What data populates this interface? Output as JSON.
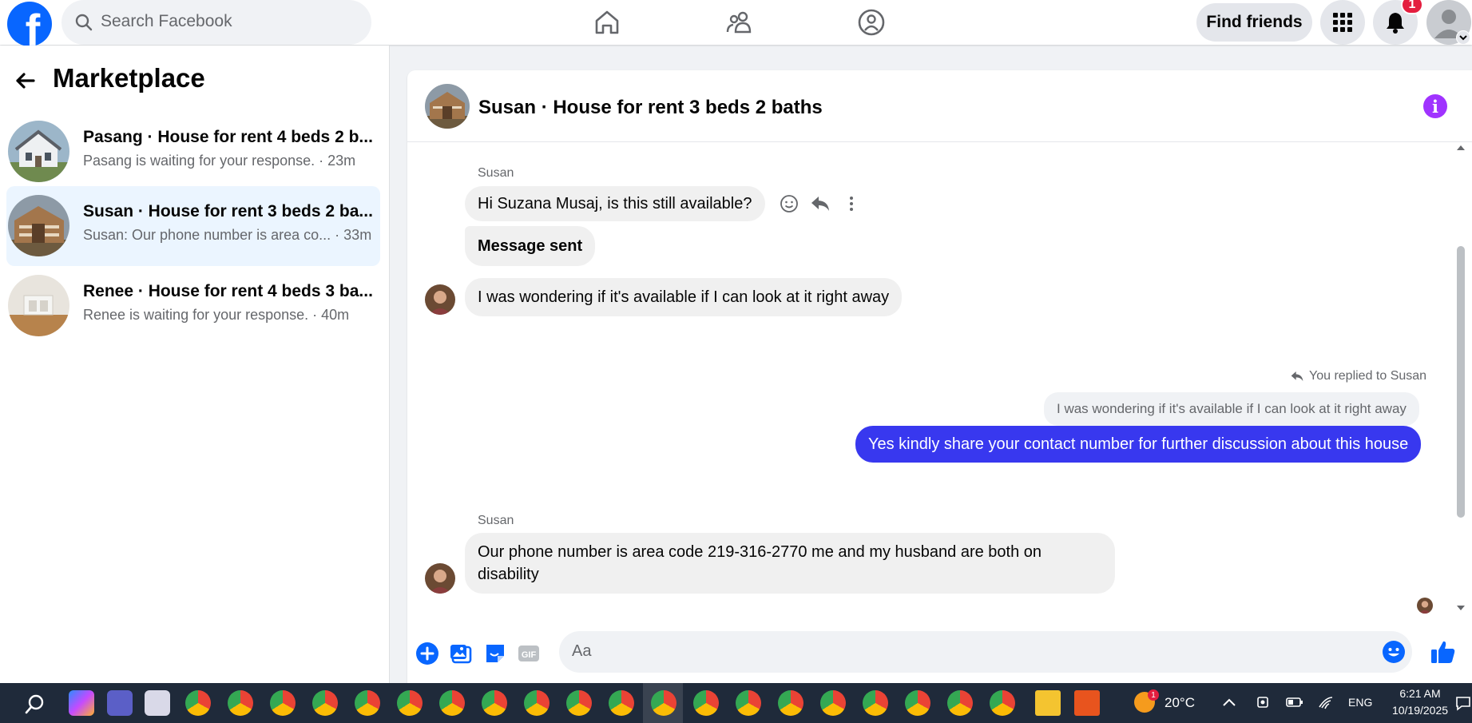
{
  "topbar": {
    "search_placeholder": "Search Facebook",
    "find_friends_label": "Find friends",
    "notification_count": "1"
  },
  "sidebar": {
    "title": "Marketplace",
    "conversations": [
      {
        "name": "Pasang · House for rent 4 beds 2 b...",
        "subtitle": "Pasang is waiting for your response. · 23m"
      },
      {
        "name": "Susan · House for rent 3 beds 2 ba...",
        "subtitle": "Susan: Our phone number is area co... · 33m"
      },
      {
        "name": "Renee · House for rent 4 beds 3 ba...",
        "subtitle": "Renee is waiting for your response. · 40m"
      }
    ]
  },
  "chat": {
    "title": "Susan · House for rent 3 beds 2 baths",
    "messages": {
      "sender1": "Susan",
      "msg1": "Hi Suzana Musaj, is this still available?",
      "msg2": "Message sent",
      "msg3": "I was wondering if it's available if I can look at it right away",
      "reply_note": "You replied to Susan",
      "quoted": "I was wondering if it's available if I can look at it right away",
      "outgoing": "Yes kindly share your contact number for further discussion about this house",
      "sender2": "Susan",
      "msg4": "Our phone number is area code 219-316-2770 me and my husband are both on disability"
    },
    "composer_placeholder": "Aa"
  },
  "taskbar": {
    "temperature": "20°C",
    "language": "ENG",
    "time": "6:21 AM",
    "date": "10/19/2025",
    "weather_badge": "1"
  },
  "colors": {
    "brand": "#0866ff",
    "outgoing_bubble": "#3838ef",
    "badge": "#e41e3f",
    "info": "#a033ff"
  }
}
